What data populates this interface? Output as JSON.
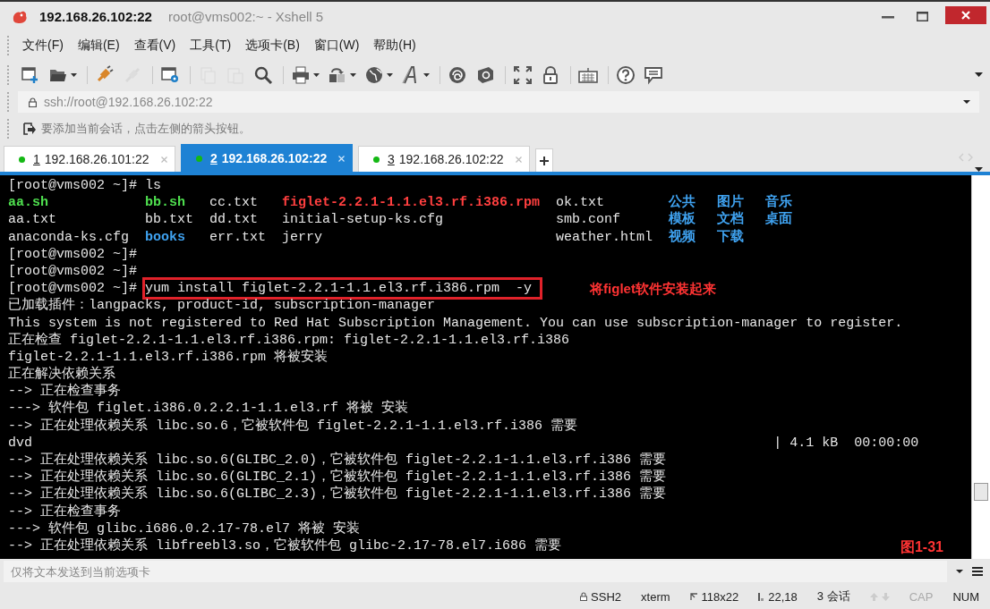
{
  "window": {
    "title_host": "192.168.26.102:22",
    "title_rest": "root@vms002:~ - Xshell 5"
  },
  "menu": [
    "文件(F)",
    "编辑(E)",
    "查看(V)",
    "工具(T)",
    "选项卡(B)",
    "窗口(W)",
    "帮助(H)"
  ],
  "toolbar": [
    {
      "kind": "new",
      "disabled": false,
      "dropdown": false
    },
    {
      "kind": "open",
      "disabled": false,
      "dropdown": true
    },
    {
      "kind": "sep"
    },
    {
      "kind": "connect",
      "disabled": false,
      "dropdown": false
    },
    {
      "kind": "disconnect",
      "disabled": true,
      "dropdown": false
    },
    {
      "kind": "sep"
    },
    {
      "kind": "properties",
      "disabled": false,
      "dropdown": false
    },
    {
      "kind": "sep"
    },
    {
      "kind": "copy",
      "disabled": true,
      "dropdown": false
    },
    {
      "kind": "paste",
      "disabled": true,
      "dropdown": false
    },
    {
      "kind": "find",
      "disabled": false,
      "dropdown": false
    },
    {
      "kind": "sep"
    },
    {
      "kind": "print",
      "disabled": false,
      "dropdown": true
    },
    {
      "kind": "transfer",
      "disabled": false,
      "dropdown": true
    },
    {
      "kind": "globe",
      "disabled": false,
      "dropdown": true
    },
    {
      "kind": "font",
      "disabled": false,
      "dropdown": true
    },
    {
      "kind": "sep"
    },
    {
      "kind": "swirl",
      "disabled": false,
      "dropdown": false
    },
    {
      "kind": "script",
      "disabled": false,
      "dropdown": false
    },
    {
      "kind": "sep"
    },
    {
      "kind": "fullscreen",
      "disabled": false,
      "dropdown": false
    },
    {
      "kind": "lock",
      "disabled": false,
      "dropdown": false
    },
    {
      "kind": "sep"
    },
    {
      "kind": "keyboard",
      "disabled": false,
      "dropdown": false
    },
    {
      "kind": "sep"
    },
    {
      "kind": "help",
      "disabled": false,
      "dropdown": false
    },
    {
      "kind": "chat",
      "disabled": false,
      "dropdown": false
    }
  ],
  "address": {
    "value": "ssh://root@192.168.26.102:22"
  },
  "hint": "要添加当前会话，点击左侧的箭头按钮。",
  "tabs": [
    {
      "number": "1",
      "label": "192.168.26.101:22",
      "selected": false,
      "connected": true
    },
    {
      "number": "2",
      "label": "192.168.26.102:22",
      "selected": true,
      "connected": true
    },
    {
      "number": "3",
      "label": "192.168.26.102:22",
      "selected": false,
      "connected": true
    }
  ],
  "terminal": {
    "lines": [
      {
        "kind": "text",
        "text": "[root@vms002 ~]# ls"
      },
      {
        "kind": "ls",
        "cells": [
          {
            "text": "aa.sh",
            "color": "#4fe04f",
            "bold": true
          },
          {
            "text": "bb.sh",
            "color": "#4fe04f",
            "bold": true
          },
          {
            "text": "cc.txt",
            "color": "#e6e6e6",
            "bold": false
          },
          {
            "text": "figlet-2.2.1-1.1.el3.rf.i386.rpm",
            "color": "#ff3f3f",
            "bold": true
          },
          {
            "text": "ok.txt",
            "color": "#e6e6e6",
            "bold": false
          },
          {
            "text": "公共",
            "color": "#3fa2f0",
            "bold": true
          },
          {
            "text": "图片",
            "color": "#3fa2f0",
            "bold": true
          },
          {
            "text": "音乐",
            "color": "#3fa2f0",
            "bold": true
          }
        ]
      },
      {
        "kind": "ls",
        "cells": [
          {
            "text": "aa.txt",
            "color": "#e6e6e6",
            "bold": false
          },
          {
            "text": "bb.txt",
            "color": "#e6e6e6",
            "bold": false
          },
          {
            "text": "dd.txt",
            "color": "#e6e6e6",
            "bold": false
          },
          {
            "text": "initial-setup-ks.cfg",
            "color": "#e6e6e6",
            "bold": false
          },
          {
            "text": "smb.conf",
            "color": "#e6e6e6",
            "bold": false
          },
          {
            "text": "模板",
            "color": "#3fa2f0",
            "bold": true
          },
          {
            "text": "文档",
            "color": "#3fa2f0",
            "bold": true
          },
          {
            "text": "桌面",
            "color": "#3fa2f0",
            "bold": true
          }
        ]
      },
      {
        "kind": "ls",
        "cells": [
          {
            "text": "anaconda-ks.cfg",
            "color": "#e6e6e6",
            "bold": false
          },
          {
            "text": "books",
            "color": "#3fa2f0",
            "bold": true
          },
          {
            "text": "err.txt",
            "color": "#e6e6e6",
            "bold": false
          },
          {
            "text": "jerry",
            "color": "#e6e6e6",
            "bold": false
          },
          {
            "text": "weather.html",
            "color": "#e6e6e6",
            "bold": false
          },
          {
            "text": "视频",
            "color": "#3fa2f0",
            "bold": true
          },
          {
            "text": "下载",
            "color": "#3fa2f0",
            "bold": true
          }
        ]
      },
      {
        "kind": "text",
        "text": "[root@vms002 ~]#"
      },
      {
        "kind": "text",
        "text": "[root@vms002 ~]#"
      },
      {
        "kind": "command",
        "prompt": "[root@vms002 ~]#",
        "command": "yum install figlet-2.2.1-1.1.el3.rf.i386.rpm  -y",
        "note": "将figlet软件安装起来"
      },
      {
        "kind": "text",
        "text": "已加载插件：langpacks, product-id, subscription-manager"
      },
      {
        "kind": "text",
        "text": "This system is not registered to Red Hat Subscription Management. You can use subscription-manager to register."
      },
      {
        "kind": "text",
        "text": "正在检查 figlet-2.2.1-1.1.el3.rf.i386.rpm: figlet-2.2.1-1.1.el3.rf.i386"
      },
      {
        "kind": "text",
        "text": "figlet-2.2.1-1.1.el3.rf.i386.rpm 将被安装"
      },
      {
        "kind": "text",
        "text": "正在解决依赖关系"
      },
      {
        "kind": "text",
        "text": "--> 正在检查事务"
      },
      {
        "kind": "text",
        "text": "---> 软件包 figlet.i386.0.2.2.1-1.1.el3.rf 将被 安装"
      },
      {
        "kind": "text",
        "text": "--> 正在处理依赖关系 libc.so.6，它被软件包 figlet-2.2.1-1.1.el3.rf.i386 需要"
      },
      {
        "kind": "progress",
        "text": "dvd",
        "detail": "| 4.1 kB  00:00:00"
      },
      {
        "kind": "text",
        "text": "--> 正在处理依赖关系 libc.so.6(GLIBC_2.0)，它被软件包 figlet-2.2.1-1.1.el3.rf.i386 需要"
      },
      {
        "kind": "text",
        "text": "--> 正在处理依赖关系 libc.so.6(GLIBC_2.1)，它被软件包 figlet-2.2.1-1.1.el3.rf.i386 需要"
      },
      {
        "kind": "text",
        "text": "--> 正在处理依赖关系 libc.so.6(GLIBC_2.3)，它被软件包 figlet-2.2.1-1.1.el3.rf.i386 需要"
      },
      {
        "kind": "text",
        "text": "--> 正在检查事务"
      },
      {
        "kind": "text",
        "text": "---> 软件包 glibc.i686.0.2.17-78.el7 将被 安装"
      },
      {
        "kind": "text",
        "text": "--> 正在处理依赖关系 libfreebl3.so，它被软件包 glibc-2.17-78.el7.i686 需要"
      }
    ],
    "figure_label": "图1-31"
  },
  "compose": {
    "placeholder": "仅将文本发送到当前选项卡"
  },
  "status_bar": [
    {
      "kind": "protocol",
      "text": "SSH2",
      "disabled": false
    },
    {
      "kind": "plain",
      "text": "xterm",
      "disabled": false
    },
    {
      "kind": "size",
      "text": "118x22",
      "disabled": false
    },
    {
      "kind": "cursor",
      "text": "22,18",
      "disabled": false
    },
    {
      "kind": "plain",
      "text": "3 会话",
      "disabled": false
    },
    {
      "kind": "arrows"
    },
    {
      "kind": "plain",
      "text": "CAP",
      "disabled": true
    },
    {
      "kind": "plain",
      "text": "NUM",
      "disabled": false
    }
  ]
}
